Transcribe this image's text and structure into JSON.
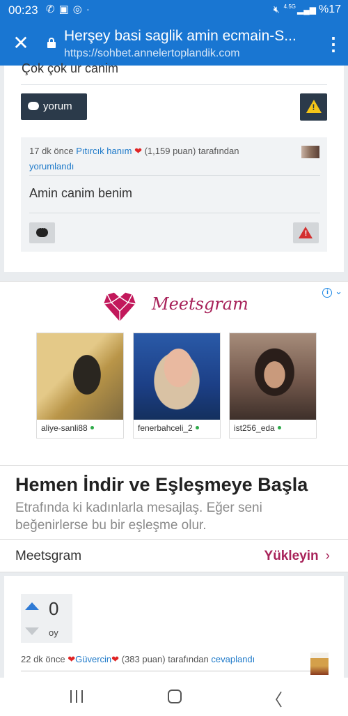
{
  "status_bar": {
    "time": "00:23",
    "notification_icons": [
      "whatsapp-icon",
      "vk-icon",
      "instagram-icon",
      "dot"
    ],
    "network_type": "4.5G",
    "battery": "%17"
  },
  "browser": {
    "page_title": "Herşey basi saglik amin ecmain-S...",
    "url": "https://sohbet.annelertoplandik.com"
  },
  "post_partial_text": "Çok çok ur canim",
  "actions": {
    "comment_label": "yorum"
  },
  "comment": {
    "time_ago": "17 dk önce",
    "author": "Pıtırcık hanım",
    "points": "(1,159 puan)",
    "by_text": "tarafından",
    "action": "yorumlandı",
    "text": "Amin canim benim"
  },
  "ad": {
    "brand": "Meetsgram",
    "profiles": [
      {
        "username": "aliye-sanli88"
      },
      {
        "username": "fenerbahceli_2"
      },
      {
        "username": "ist256_eda"
      }
    ],
    "headline": "Hemen İndir ve Eşleşmeye Başla",
    "body": "Etrafında ki kadınlarla mesajlaş. Eğer seni beğenirlerse bu bir eşleşme olur.",
    "cta": "Yükleyin",
    "brand_color": "#a8235a"
  },
  "answer": {
    "vote_count": "0",
    "vote_label": "oy",
    "time_ago": "22 dk önce",
    "author": "Güvercin",
    "points": "(383 puan)",
    "by_text": "tarafından",
    "action": "cevaplandı"
  },
  "colors": {
    "chrome_blue": "#1976d2",
    "link_blue": "#1f7ac9",
    "dark_button": "#2b3a4a",
    "warning_yellow": "#f5c518",
    "warning_red": "#d32f2f"
  }
}
